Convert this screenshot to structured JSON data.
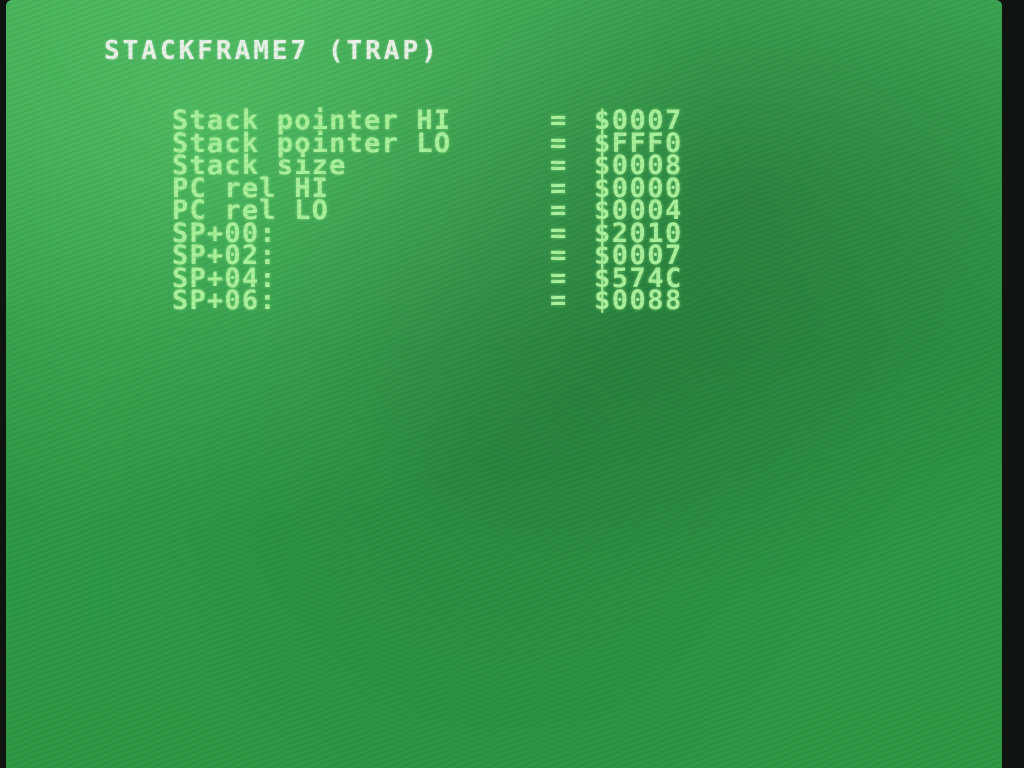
{
  "screen": {
    "title": "STACKFRAME7 (TRAP)"
  },
  "rows": [
    {
      "label": "Stack pointer HI",
      "eq": "=",
      "value": "$0007"
    },
    {
      "label": "Stack pointer LO",
      "eq": "=",
      "value": "$FFF0"
    },
    {
      "label": "Stack size",
      "eq": "=",
      "value": "$0008"
    },
    {
      "label": "PC rel HI",
      "eq": "=",
      "value": "$0000"
    },
    {
      "label": "PC rel LO",
      "eq": "=",
      "value": "$0004"
    },
    {
      "label": "SP+00:",
      "eq": "=",
      "value": "$2010"
    },
    {
      "label": "SP+02:",
      "eq": "=",
      "value": "$0007"
    },
    {
      "label": "SP+04:",
      "eq": "=",
      "value": "$574C"
    },
    {
      "label": "SP+06:",
      "eq": "=",
      "value": "$0088"
    }
  ],
  "colors": {
    "background": "#35a24c",
    "text": "#a9f19c",
    "title": "#e8f2e6"
  }
}
